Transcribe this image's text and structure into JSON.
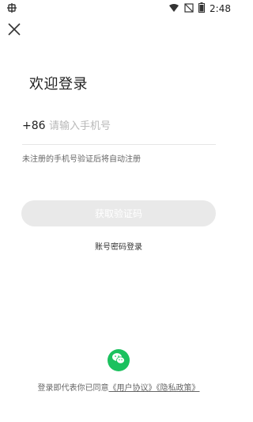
{
  "status_bar": {
    "time": "2:48",
    "icons": [
      "wifi-icon",
      "signal-off-icon",
      "battery-icon"
    ],
    "app_icon": "bug-icon"
  },
  "header": {
    "close_icon": "close-icon"
  },
  "main": {
    "title": "欢迎登录",
    "country_code": "+86",
    "phone_placeholder": "请输入手机号",
    "hint": "未注册的手机号验证后将自动注册",
    "get_code_label": "获取验证码",
    "password_login_label": "账号密码登录"
  },
  "footer": {
    "wechat_icon": "wechat-icon",
    "agreement_prefix": "登录即代表你已同意",
    "user_agreement": "《用户协议》",
    "privacy_policy": "《隐私政策》"
  },
  "colors": {
    "wechat_green": "#1bc15e",
    "button_disabled": "#e9e9e9",
    "placeholder": "#b8b8b8"
  }
}
